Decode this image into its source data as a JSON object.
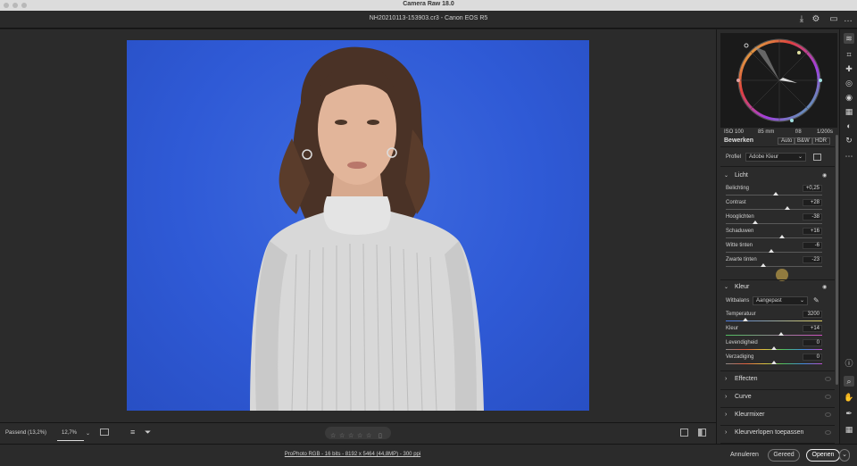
{
  "app": {
    "title": "Camera Raw 18.0"
  },
  "file": {
    "title": "NH20210113-153903.cr3  -  Canon EOS R5"
  },
  "camera_info": {
    "iso": "ISO 100",
    "focal": "85 mm",
    "aperture": "f/8",
    "shutter": "1/200s"
  },
  "edit": {
    "title": "Bewerken",
    "auto": "Auto",
    "bw": "B&W",
    "hdr": "HDR",
    "profile_label": "Profiel",
    "profile_value": "Adobe Kleur"
  },
  "light": {
    "title": "Licht",
    "sliders": [
      {
        "label": "Belichting",
        "value": "+0,25",
        "pos": 0.52
      },
      {
        "label": "Contrast",
        "value": "+28",
        "pos": 0.64
      },
      {
        "label": "Hooglichten",
        "value": "-38",
        "pos": 0.31
      },
      {
        "label": "Schaduwen",
        "value": "+16",
        "pos": 0.58
      },
      {
        "label": "Witte tinten",
        "value": "-6",
        "pos": 0.47
      },
      {
        "label": "Zwarte tinten",
        "value": "-23",
        "pos": 0.39
      }
    ]
  },
  "color": {
    "title": "Kleur",
    "wb_label": "Witbalans",
    "wb_value": "Aangepast",
    "sliders": [
      {
        "label": "Temperatuur",
        "value": "3200",
        "pos": 0.2
      },
      {
        "label": "Kleur",
        "value": "+14",
        "pos": 0.57
      },
      {
        "label": "Levendigheid",
        "value": "0",
        "pos": 0.5
      },
      {
        "label": "Verzadiging",
        "value": "0",
        "pos": 0.5
      }
    ]
  },
  "sections": [
    "Effecten",
    "Curve",
    "Kleurmixer",
    "Kleurverlopen toepassen"
  ],
  "bottombar": {
    "fit": "Passend (13,2%)",
    "zoom": "12,7%"
  },
  "footer": {
    "info": "ProPhoto RGB - 16 bits - 8192 x 5464 (44,8MP) - 300 ppi",
    "cancel": "Annuleren",
    "done": "Gereed",
    "open": "Openen"
  },
  "colors": {
    "background": "#3a66dc",
    "panel": "#2b2b2b"
  }
}
